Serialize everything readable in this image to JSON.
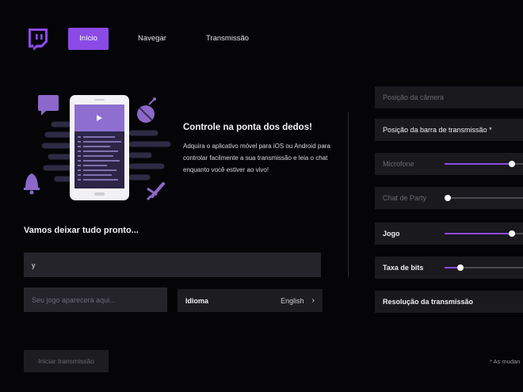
{
  "nav": {
    "items": [
      {
        "label": "Início",
        "active": true
      },
      {
        "label": "Navegar",
        "active": false
      },
      {
        "label": "Transmissão",
        "active": false
      }
    ]
  },
  "hero": {
    "title": "Controle na ponta dos dedos!",
    "body": "Adquira o aplicativo móvel para iOS ou Android para controlar facilmente a sua transmissão e leia o chat enquanto você estiver ao vivo!"
  },
  "setup": {
    "title": "Vamos deixar tudo pronto...",
    "title_value": "y",
    "game_placeholder": "Seu jogo aparecera aqui...",
    "language_label": "Idioma",
    "language_value": "English",
    "start_button": "Iniciar transmissão"
  },
  "settings": {
    "items": [
      {
        "label": "Posição da câmera",
        "state": "dim"
      },
      {
        "label": "Posição da barra de transmissão *",
        "state": "bright"
      },
      {
        "label": "Microfone",
        "state": "dim",
        "level": 0.93
      },
      {
        "label": "Chat de Party",
        "state": "dim",
        "level": 0.04
      },
      {
        "label": "Jogo",
        "state": "bold",
        "level": 0.93
      },
      {
        "label": "Taxa de bits",
        "state": "bold",
        "level": 0.22
      },
      {
        "label": "Resolução da transmissão",
        "state": "bold"
      }
    ],
    "note": "* As mudan"
  },
  "colors": {
    "accent": "#8b4ae6",
    "panel": "#1a191e",
    "background": "#050507"
  }
}
